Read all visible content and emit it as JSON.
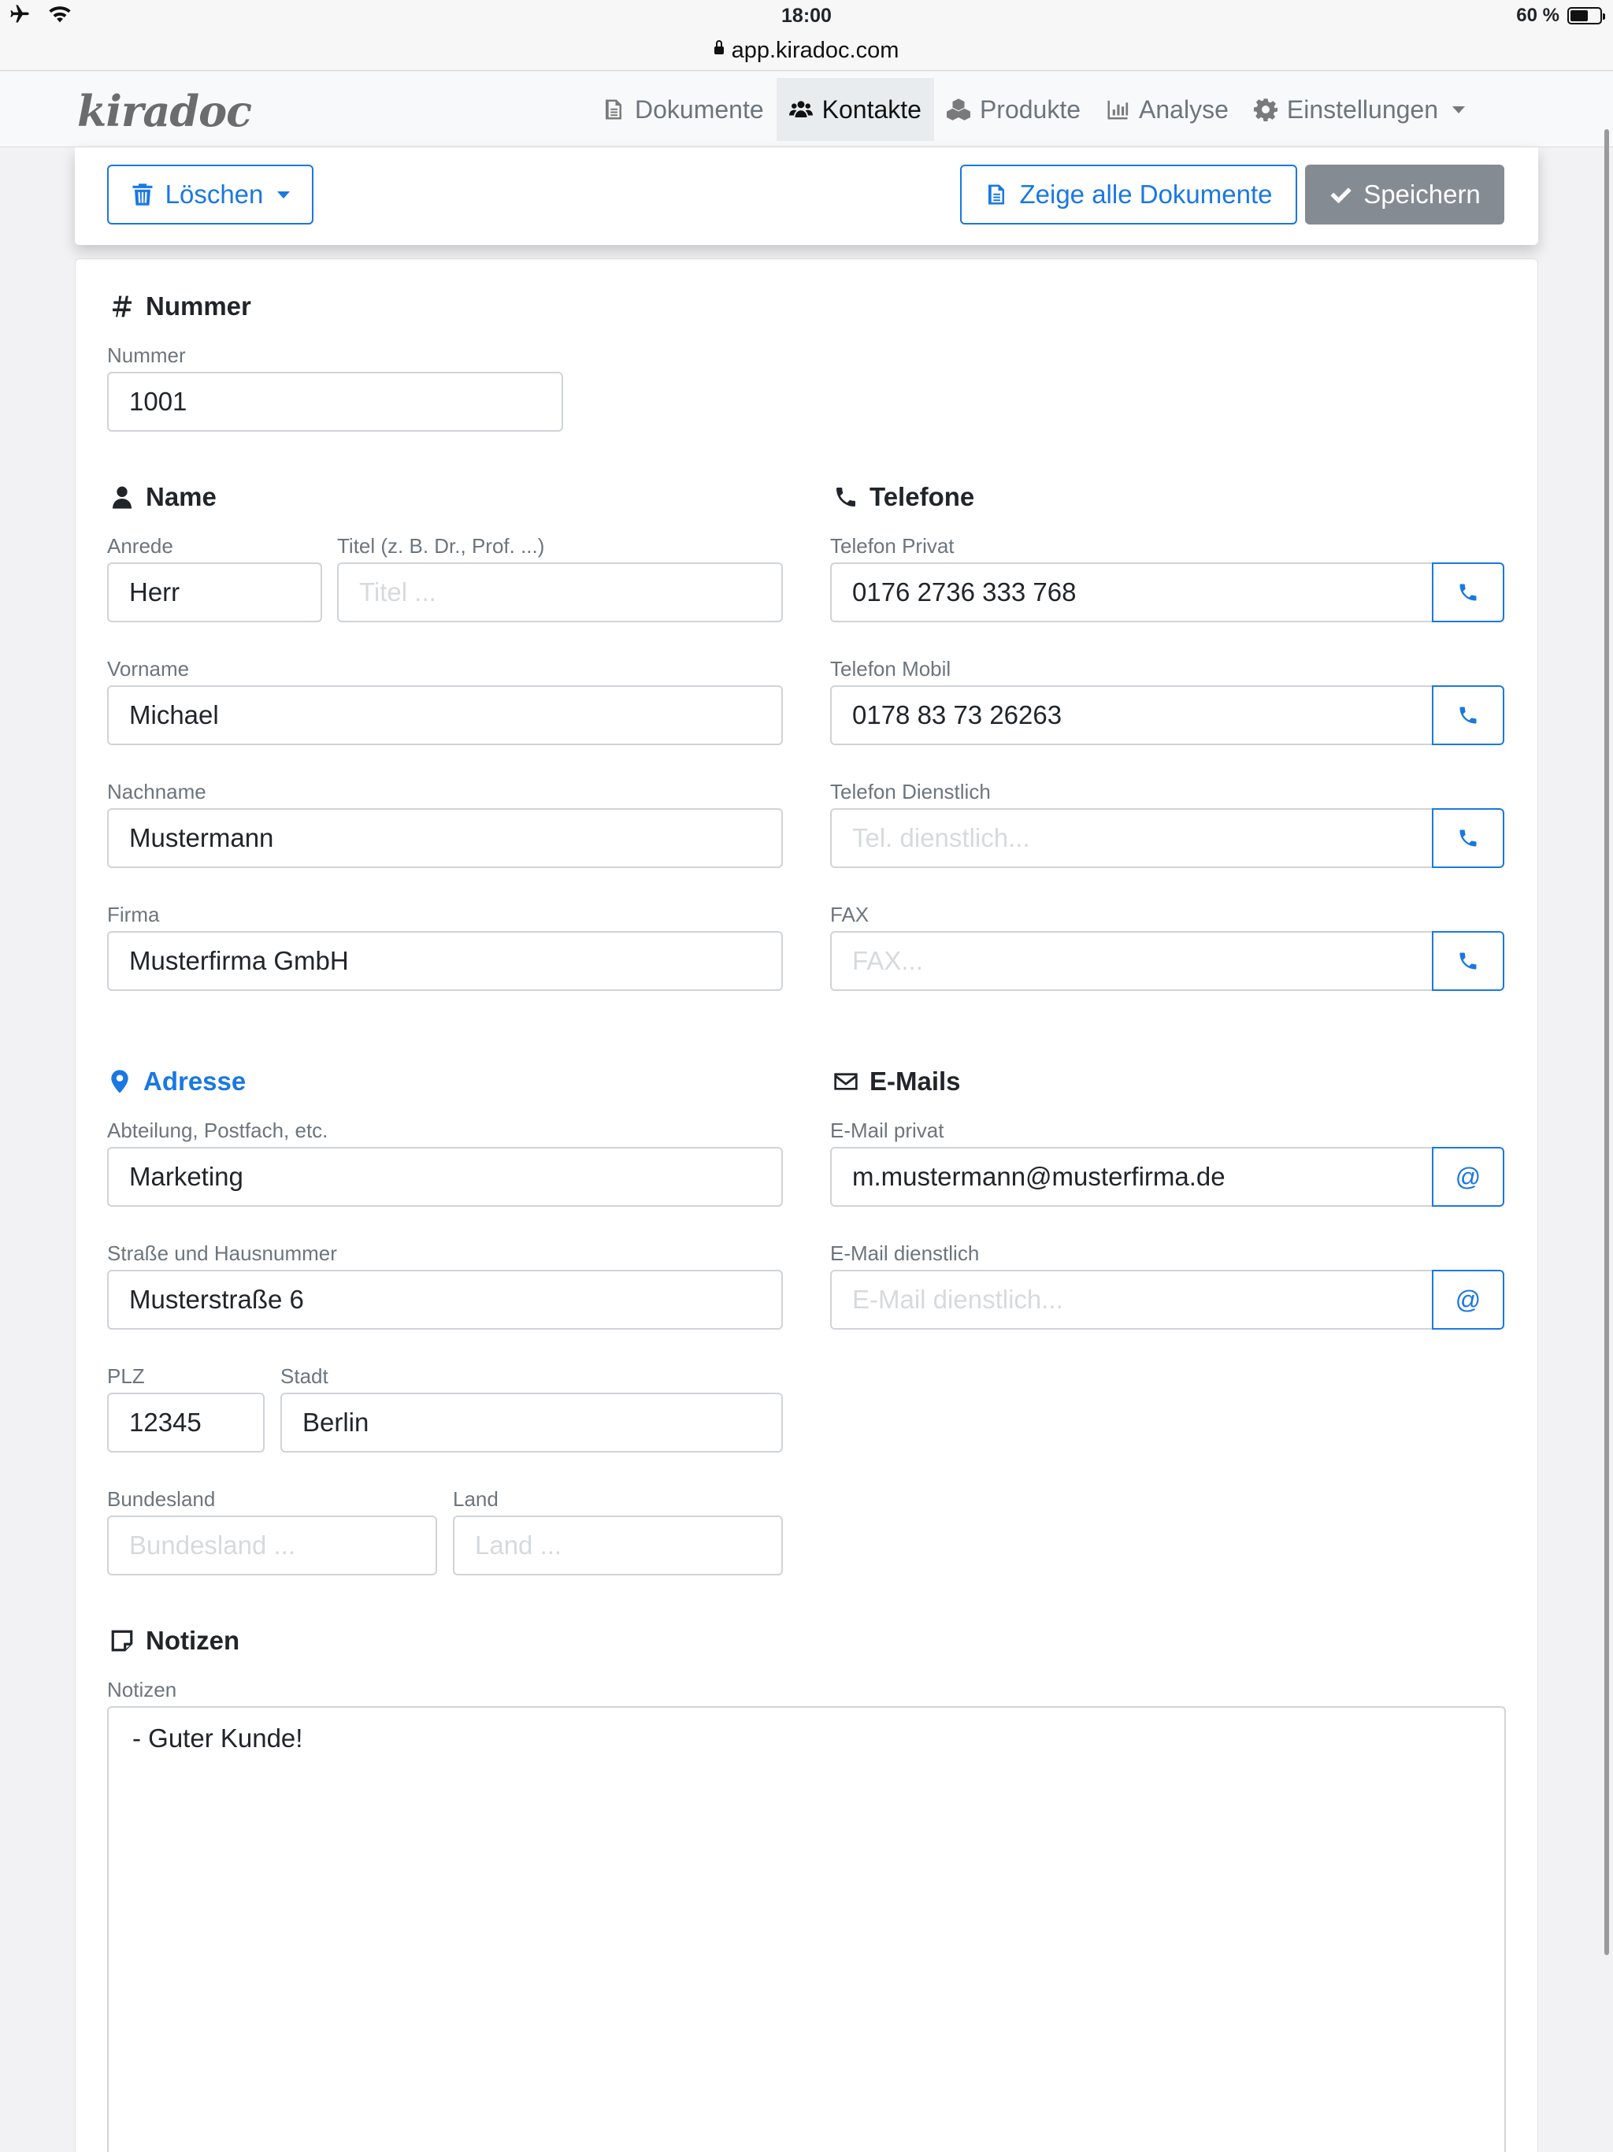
{
  "status_bar": {
    "time": "18:00",
    "battery": "60 %",
    "battery_level": 0.6
  },
  "browser": {
    "url": "app.kiradoc.com"
  },
  "app": {
    "logo": "kiradoc"
  },
  "nav": {
    "dokumente": "Dokumente",
    "kontakte": "Kontakte",
    "produkte": "Produkte",
    "analyse": "Analyse",
    "einstellungen": "Einstellungen",
    "active": "Kontakte"
  },
  "toolbar": {
    "delete_label": "Löschen",
    "show_docs_label": "Zeige alle Dokumente",
    "save_label": "Speichern"
  },
  "sections": {
    "nummer": "Nummer",
    "name": "Name",
    "telefone": "Telefone",
    "adresse": "Adresse",
    "emails": "E-Mails",
    "notizen": "Notizen"
  },
  "fields": {
    "nummer": {
      "label": "Nummer",
      "value": "1001"
    },
    "anrede": {
      "label": "Anrede",
      "value": "Herr"
    },
    "titel": {
      "label": "Titel (z. B. Dr., Prof. ...)",
      "placeholder": "Titel ..."
    },
    "vorname": {
      "label": "Vorname",
      "value": "Michael"
    },
    "nachname": {
      "label": "Nachname",
      "value": "Mustermann"
    },
    "firma": {
      "label": "Firma",
      "value": "Musterfirma GmbH"
    },
    "tel_privat": {
      "label": "Telefon Privat",
      "value": "0176 2736 333 768"
    },
    "tel_mobil": {
      "label": "Telefon Mobil",
      "value": "0178 83 73 26263"
    },
    "tel_dienst": {
      "label": "Telefon Dienstlich",
      "placeholder": "Tel. dienstlich..."
    },
    "fax": {
      "label": "FAX",
      "placeholder": "FAX..."
    },
    "abteilung": {
      "label": "Abteilung, Postfach, etc.",
      "value": "Marketing"
    },
    "strasse": {
      "label": "Straße und Hausnummer",
      "value": "Musterstraße 6"
    },
    "plz": {
      "label": "PLZ",
      "value": "12345"
    },
    "stadt": {
      "label": "Stadt",
      "value": "Berlin"
    },
    "bundesland": {
      "label": "Bundesland",
      "placeholder": "Bundesland ..."
    },
    "land": {
      "label": "Land",
      "placeholder": "Land ..."
    },
    "email_privat": {
      "label": "E-Mail privat",
      "value": "m.mustermann@musterfirma.de"
    },
    "email_dienst": {
      "label": "E-Mail dienstlich",
      "placeholder": "E-Mail dienstlich..."
    },
    "notizen": {
      "label": "Notizen",
      "value": "- Guter Kunde!"
    },
    "at_symbol": "@"
  }
}
